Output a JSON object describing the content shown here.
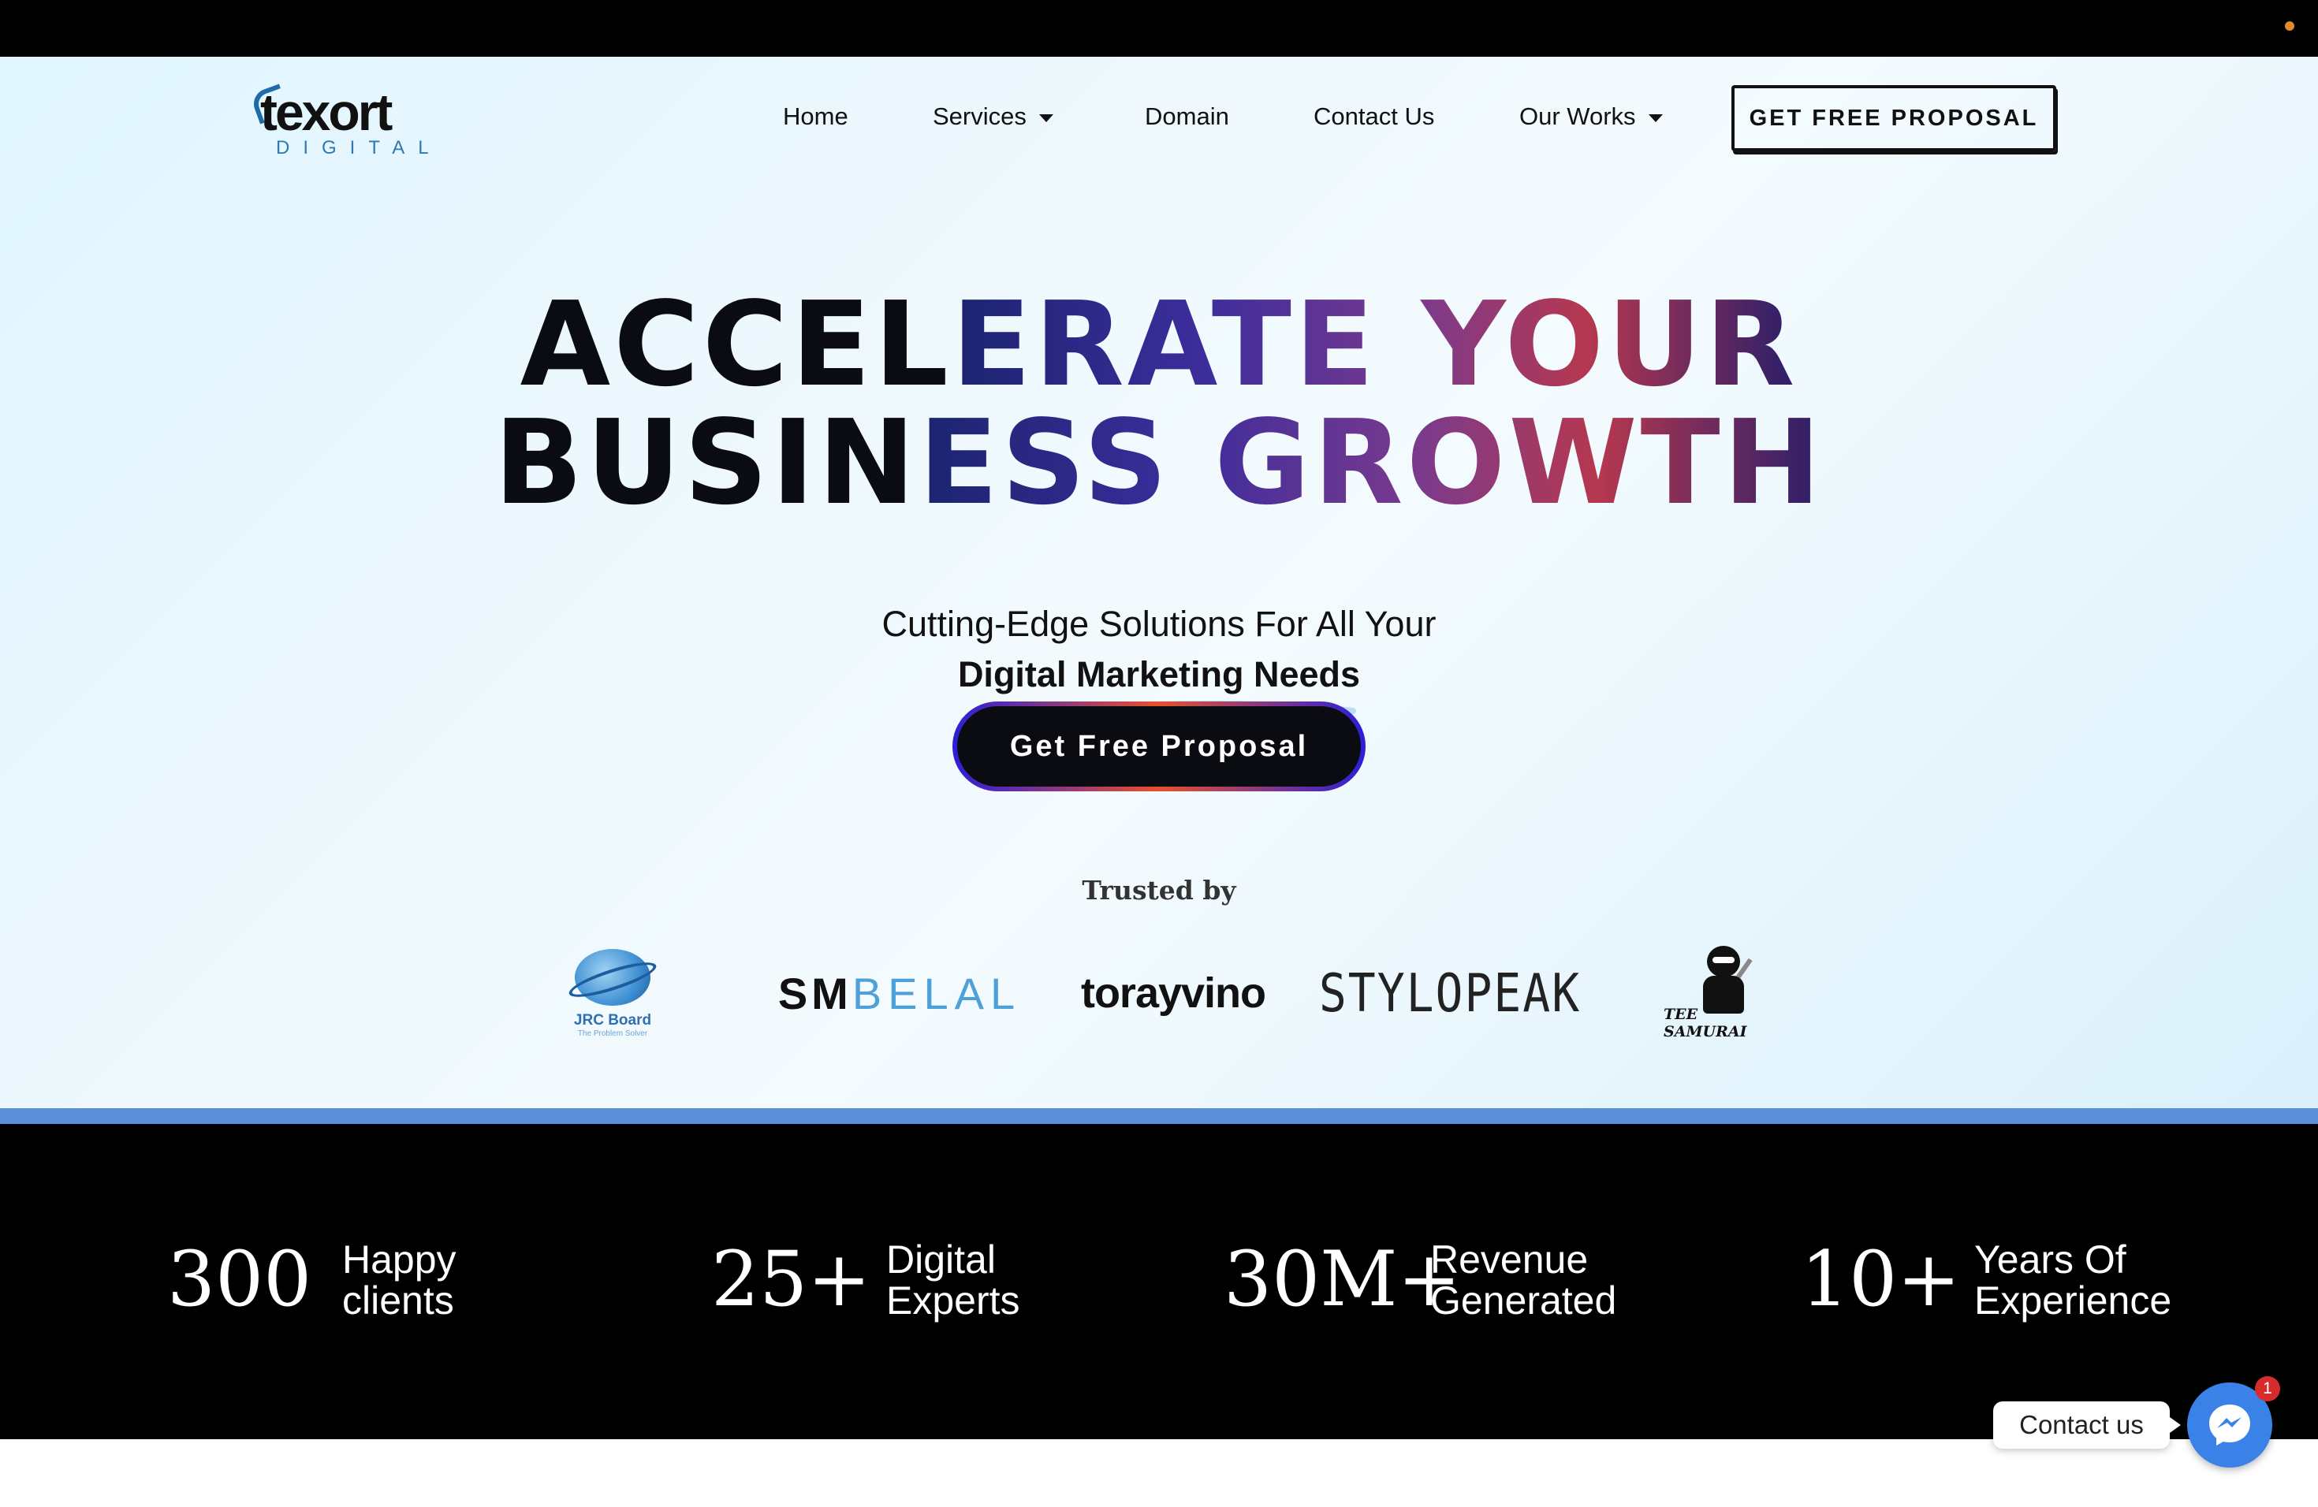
{
  "header": {
    "logo": {
      "word": "texort",
      "sub": "DIGITAL"
    },
    "nav": [
      {
        "label": "Home",
        "has_dropdown": false
      },
      {
        "label": "Services",
        "has_dropdown": true
      },
      {
        "label": "Domain",
        "has_dropdown": false
      },
      {
        "label": "Contact Us",
        "has_dropdown": false
      },
      {
        "label": "Our Works",
        "has_dropdown": true
      }
    ],
    "cta_label": "GET FREE PROPOSAL"
  },
  "hero": {
    "headline_line1_part1": "ACCEL",
    "headline_line1_part2": "ERATE YOUR",
    "headline_line2_part1": "BUSIN",
    "headline_line2_part2": "ESS GROWTH",
    "subline1": "Cutting-Edge Solutions For All Your",
    "subline2": "Digital Marketing Needs",
    "cta_label": "Get Free Proposal",
    "trusted_label": "Trusted by"
  },
  "brands": {
    "jrc_name": "JRC Board",
    "jrc_tag": "The Problem Solver",
    "smbelal_a": "SM",
    "smbelal_b": "BELAL",
    "torayvino": "torayvino",
    "stylopeak": "STYLOPEAK",
    "tee_samurai": "TEE SAMURAI"
  },
  "stats": [
    {
      "number": "300",
      "label_line1": "Happy",
      "label_line2": "clients"
    },
    {
      "number": "25+",
      "label_line1": "Digital",
      "label_line2": "Experts"
    },
    {
      "number": "30M+",
      "label_line1": "Revenue",
      "label_line2": "Generated"
    },
    {
      "number": "10+",
      "label_line1": "Years Of",
      "label_line2": "Experience"
    }
  ],
  "chat": {
    "contact_label": "Contact us",
    "badge_count": "1"
  },
  "colors": {
    "accent_blue": "#5b8fd8",
    "messenger_blue": "#3b82e8",
    "badge_red": "#d72c2c",
    "logo_blue": "#2e79b3"
  }
}
